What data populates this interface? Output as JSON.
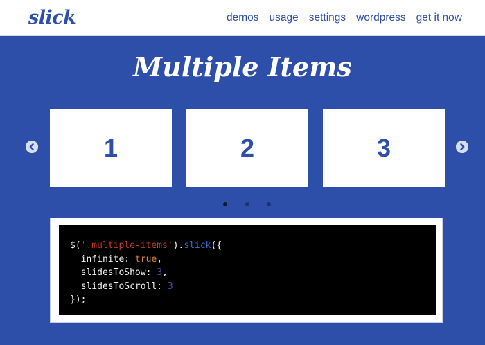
{
  "header": {
    "logo": "slick",
    "nav": [
      {
        "label": "demos"
      },
      {
        "label": "usage"
      },
      {
        "label": "settings"
      },
      {
        "label": "wordpress"
      },
      {
        "label": "get it now"
      }
    ]
  },
  "section_title": "Multiple Items",
  "carousel": {
    "slides": [
      "1",
      "2",
      "3"
    ],
    "prev_icon": "chevron-left-circle",
    "next_icon": "chevron-right-circle",
    "dot_count": 3,
    "active_dot": 1
  },
  "code": {
    "line1": {
      "a": "$(",
      "b": "'.multiple-items'",
      "c": ").",
      "d": "slick",
      "e": "({"
    },
    "line2": {
      "a": "  infinite: ",
      "b": "true",
      "c": ","
    },
    "line3": {
      "a": "  slidesToShow: ",
      "b": "3",
      "c": ","
    },
    "line4": {
      "a": "  slidesToScroll: ",
      "b": "3"
    },
    "line5": "});"
  },
  "colors": {
    "background": "#2e4fa9",
    "accent": "#2e4fa9",
    "card": "#ffffff",
    "code_bg": "#000000"
  }
}
